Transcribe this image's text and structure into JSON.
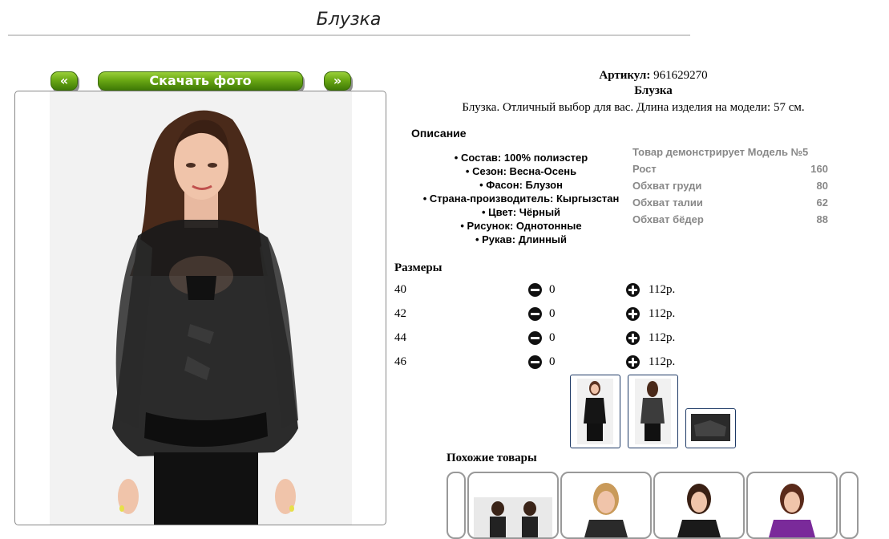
{
  "page": {
    "title": "Блузка"
  },
  "nav": {
    "prev_label": "«",
    "download_label": "Скачать фото",
    "next_label": "»"
  },
  "product": {
    "article_label": "Артикул:",
    "article_value": "961629270",
    "name": "Блузка",
    "description": "Блузка. Отличный выбор для вас. Длина изделия на модели: 57 см.",
    "description_heading": "Описание",
    "specs": [
      "• Состав: 100% полиэстер",
      "• Сезон: Весна-Осень",
      "• Фасон: Блузон",
      "• Страна-производитель: Кыргызстан",
      "• Цвет: Чёрный",
      "• Рисунок: Однотонные",
      "• Рукав: Длинный"
    ]
  },
  "model": {
    "heading": "Товар демонстрирует Модель №5",
    "rows": [
      {
        "label": "Рост",
        "value": "160"
      },
      {
        "label": "Обхват груди",
        "value": "80"
      },
      {
        "label": "Обхват талии",
        "value": "62"
      },
      {
        "label": "Обхват бёдер",
        "value": "88"
      }
    ]
  },
  "sizes": {
    "heading": "Размеры",
    "rows": [
      {
        "size": "40",
        "qty": "0",
        "price": "112р."
      },
      {
        "size": "42",
        "qty": "0",
        "price": "112р."
      },
      {
        "size": "44",
        "qty": "0",
        "price": "112р."
      },
      {
        "size": "46",
        "qty": "0",
        "price": "112р."
      }
    ]
  },
  "similar": {
    "heading": "Похожие товары"
  },
  "colors": {
    "button_green": "#6aa814",
    "thumb_border": "#1e3a66"
  }
}
